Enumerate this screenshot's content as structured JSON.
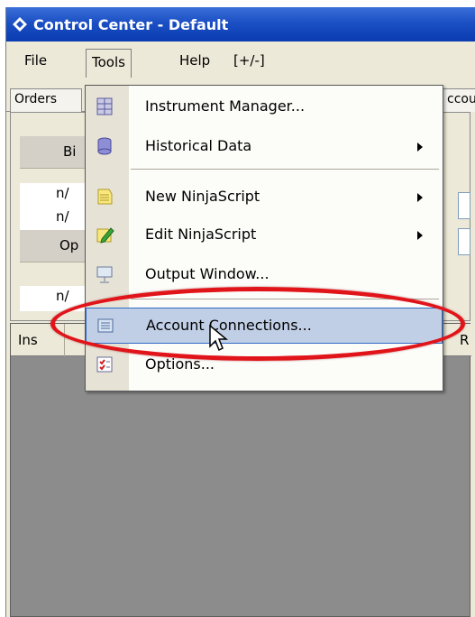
{
  "window": {
    "title": "Control Center - Default"
  },
  "menubar": {
    "items": [
      {
        "label": "File"
      },
      {
        "label": "Tools"
      },
      {
        "label": "Help"
      },
      {
        "label": "[+/-]"
      }
    ]
  },
  "tabs": {
    "left_label": "Orders",
    "right_label": "ccou"
  },
  "panel": {
    "bid_header": "Bi",
    "bid_value_1": "n/",
    "bid_value_2": "n/",
    "open_header": "Op",
    "open_value": "n/"
  },
  "grid": {
    "columns": [
      {
        "label": "Ins"
      },
      {
        "label": "R"
      }
    ]
  },
  "tools_menu": {
    "items": [
      {
        "label": "Instrument Manager...",
        "icon": "instrument-manager-icon",
        "submenu": false
      },
      {
        "label": "Historical Data",
        "icon": "database-icon",
        "submenu": true
      },
      {
        "label": "New NinjaScript",
        "icon": "notepad-icon",
        "submenu": true
      },
      {
        "label": "Edit NinjaScript",
        "icon": "edit-pencil-icon",
        "submenu": true
      },
      {
        "label": "Output Window...",
        "icon": "output-window-icon",
        "submenu": false
      },
      {
        "label": "Account Connections...",
        "icon": "account-connections-icon",
        "submenu": false,
        "highlighted": true
      },
      {
        "label": "Options...",
        "icon": "options-checklist-icon",
        "submenu": false
      }
    ]
  },
  "colors": {
    "titlebar": "#1b4fc4",
    "highlight": "#c1cfe6",
    "annotation_ellipse": "#e1141a",
    "grid_background": "#8c8c8c"
  }
}
